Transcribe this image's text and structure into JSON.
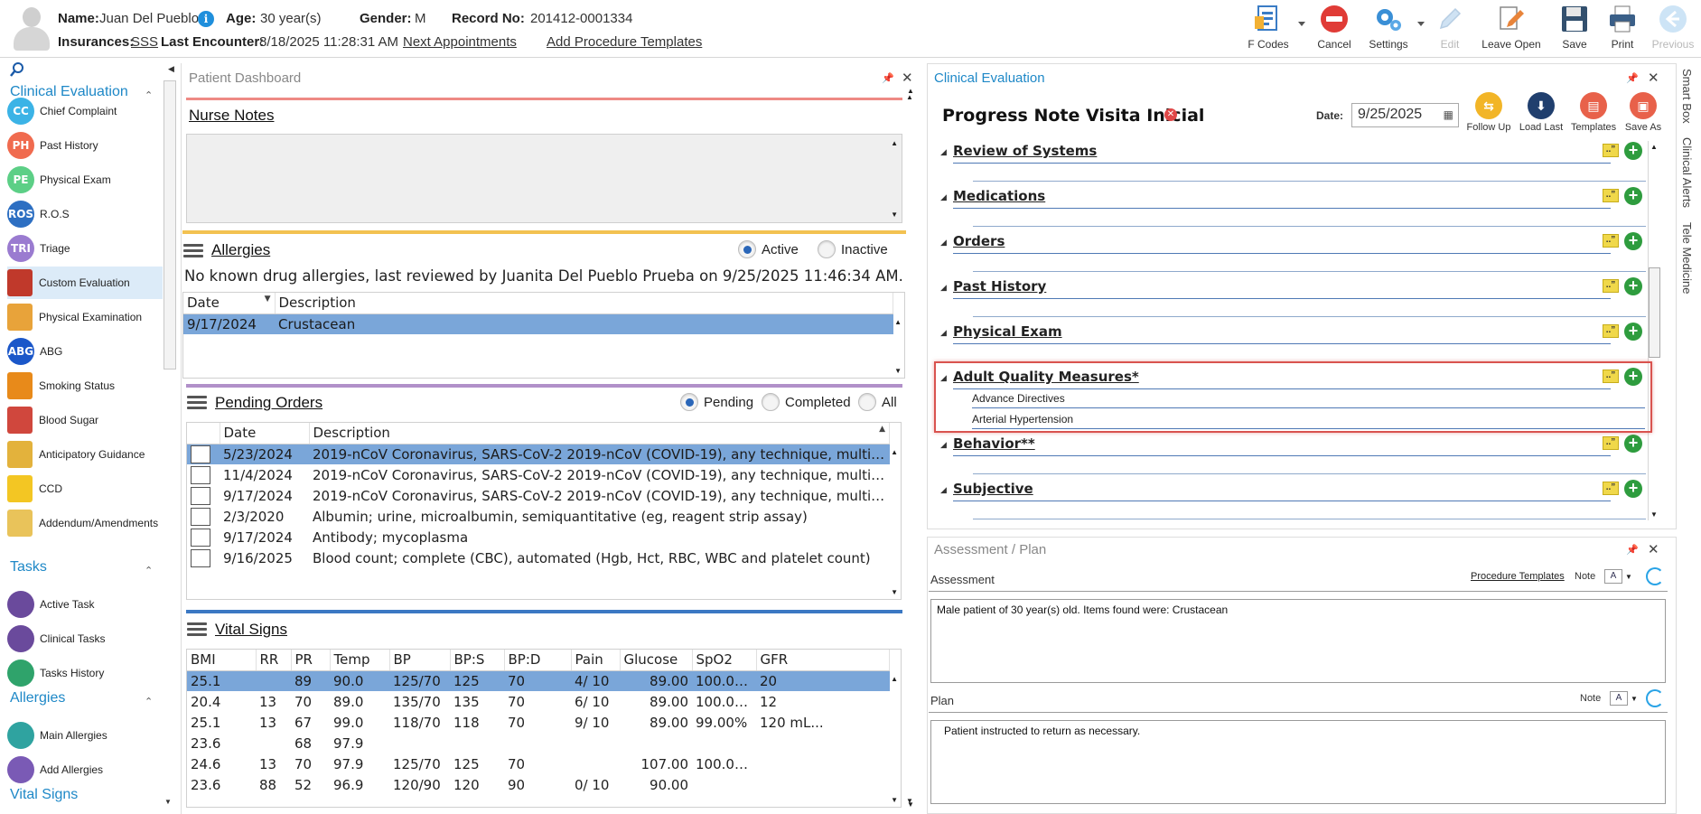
{
  "header": {
    "name_label": "Name:",
    "name_value": "Juan Del Pueblo",
    "age_label": "Age:",
    "age_value": "30 year(s)",
    "gender_label": "Gender:",
    "gender_value": "M",
    "record_label": "Record No:",
    "record_value": "201412-0001334",
    "insurances_label": "Insurances:",
    "insurances_value": "SSS",
    "last_encounter_label": "Last Encounter:",
    "last_encounter_value": "8/18/2025 11:28:31 AM",
    "next_appointments": "Next Appointments",
    "add_procedure_templates": "Add Procedure Templates",
    "info_glyph": "i"
  },
  "toolbar": {
    "fcodes": "F Codes",
    "cancel": "Cancel",
    "settings": "Settings",
    "edit": "Edit",
    "leave_open": "Leave Open",
    "save": "Save",
    "print": "Print",
    "previous": "Previous"
  },
  "leftnav": {
    "clinical_evaluation": "Clinical Evaluation",
    "clinical_items": [
      {
        "abbr": "CC",
        "label": "Chief Complaint",
        "color": "#3bb3e6"
      },
      {
        "abbr": "PH",
        "label": "Past History",
        "color": "#f06b4f"
      },
      {
        "abbr": "PE",
        "label": "Physical Exam",
        "color": "#5ccf86"
      },
      {
        "abbr": "ROS",
        "label": "R.O.S",
        "color": "#2d6fc2"
      },
      {
        "abbr": "TRI",
        "label": "Triage",
        "color": "#9a7bd0"
      },
      {
        "abbr": "",
        "label": "Custom Evaluation",
        "color": "#c0392b"
      },
      {
        "abbr": "",
        "label": "Physical Examination",
        "color": "#e8a33a"
      },
      {
        "abbr": "ABG",
        "label": "ABG",
        "color": "#1b57c9"
      },
      {
        "abbr": "",
        "label": "Smoking Status",
        "color": "#e88a1a"
      },
      {
        "abbr": "",
        "label": "Blood Sugar",
        "color": "#d0473d"
      },
      {
        "abbr": "",
        "label": "Anticipatory Guidance",
        "color": "#e3b23c"
      },
      {
        "abbr": "",
        "label": "CCD",
        "color": "#f3c623"
      },
      {
        "abbr": "",
        "label": "Addendum/Amendments",
        "color": "#e9c35a"
      }
    ],
    "tasks": "Tasks",
    "task_items": [
      {
        "label": "Active Task",
        "color": "#6a4a9c"
      },
      {
        "label": "Clinical Tasks",
        "color": "#6a4a9c"
      },
      {
        "label": "Tasks History",
        "color": "#2fa36b"
      }
    ],
    "allergies": "Allergies",
    "allergy_items": [
      {
        "label": "Main Allergies",
        "color": "#2fa3a0"
      },
      {
        "label": "Add Allergies",
        "color": "#7a5ab5"
      }
    ],
    "vital_signs": "Vital Signs"
  },
  "dashboard": {
    "title": "Patient Dashboard",
    "nurse_notes": "Nurse Notes",
    "allergies": {
      "title": "Allergies",
      "radio_active": "Active",
      "radio_inactive": "Inactive",
      "summary": "No known drug allergies, last reviewed by Juanita Del Pueblo Prueba on 9/25/2025 11:46:34 AM.",
      "col_date": "Date",
      "col_description": "Description",
      "rows": [
        {
          "date": "9/17/2024",
          "description": "Crustacean"
        }
      ]
    },
    "pending_orders": {
      "title": "Pending Orders",
      "radio_pending": "Pending",
      "radio_completed": "Completed",
      "radio_all": "All",
      "col_date": "Date",
      "col_description": "Description",
      "rows": [
        {
          "date": "5/23/2024",
          "description": "2019-nCoV Coronavirus, SARS-CoV-2 2019-nCoV (COVID-19), any technique, multiple t..."
        },
        {
          "date": "11/4/2024",
          "description": "2019-nCoV Coronavirus, SARS-CoV-2 2019-nCoV (COVID-19), any technique, multiple t..."
        },
        {
          "date": "9/17/2024",
          "description": "2019-nCoV Coronavirus, SARS-CoV-2 2019-nCoV (COVID-19), any technique, multiple t..."
        },
        {
          "date": "2/3/2020",
          "description": "Albumin; urine, microalbumin, semiquantitative (eg, reagent strip assay)"
        },
        {
          "date": "9/17/2024",
          "description": "Antibody; mycoplasma"
        },
        {
          "date": "9/16/2025",
          "description": "Blood count; complete (CBC), automated (Hgb, Hct, RBC, WBC and platelet count)"
        }
      ]
    },
    "vital_signs": {
      "title": "Vital Signs",
      "columns": [
        "BMI",
        "RR",
        "PR",
        "Temp",
        "BP",
        "BP:S",
        "BP:D",
        "Pain",
        "Glucose",
        "SpO2",
        "GFR"
      ],
      "rows": [
        [
          "25.1",
          "",
          "89",
          "90.0",
          "125/70",
          "125",
          "70",
          "4/ 10",
          "89.00",
          "100.00%",
          "20"
        ],
        [
          "20.4",
          "13",
          "70",
          "89.0",
          "135/70",
          "135",
          "70",
          "6/ 10",
          "89.00",
          "100.00%",
          "12"
        ],
        [
          "25.1",
          "13",
          "67",
          "99.0",
          "118/70",
          "118",
          "70",
          "9/ 10",
          "89.00",
          "99.00%",
          "120 mL..."
        ],
        [
          "23.6",
          "",
          "68",
          "97.9",
          "",
          "",
          "",
          "",
          "",
          "",
          ""
        ],
        [
          "24.6",
          "13",
          "70",
          "97.9",
          "125/70",
          "125",
          "70",
          "",
          "107.00",
          "100.00%",
          ""
        ],
        [
          "23.6",
          "88",
          "52",
          "96.9",
          "120/90",
          "120",
          "90",
          "0/ 10",
          "90.00",
          "",
          ""
        ]
      ]
    }
  },
  "clinical_evaluation": {
    "title": "Clinical Evaluation",
    "note_title": "Progress Note Visita Inicial",
    "date_label": "Date:",
    "date_value": "9/25/2025",
    "actions": {
      "follow_up": "Follow Up",
      "load_last": "Load Last",
      "templates": "Templates",
      "save_as": "Save As"
    },
    "quote_glyph": "..”",
    "sections": [
      {
        "title": "Review of Systems",
        "items": []
      },
      {
        "title": "Medications",
        "items": []
      },
      {
        "title": "Orders",
        "items": []
      },
      {
        "title": "Past History",
        "items": []
      },
      {
        "title": "Physical Exam",
        "items": []
      },
      {
        "title": "Adult Quality Measures*",
        "items": [
          "Advance Directives",
          "Arterial Hypertension"
        ]
      },
      {
        "title": "Behavior**",
        "items": []
      },
      {
        "title": "Subjective",
        "items": []
      }
    ]
  },
  "side_tabs": {
    "smart_box": "Smart Box",
    "clinical_alerts": "Clinical Alerts",
    "tele_medicine": "Tele Medicine"
  },
  "assessment_plan": {
    "title": "Assessment / Plan",
    "assessment_label": "Assessment",
    "procedure_templates": "Procedure Templates",
    "note_label": "Note",
    "assessment_text": "Male patient of 30 year(s) old. Items found were:  Crustacean",
    "plan_label": "Plan",
    "plan_text": "Patient instructed to return as necessary."
  },
  "colors": {
    "accent_blue": "#1e88c7",
    "selection": "#7aa6d9",
    "highlight_box": "#d9534f"
  }
}
